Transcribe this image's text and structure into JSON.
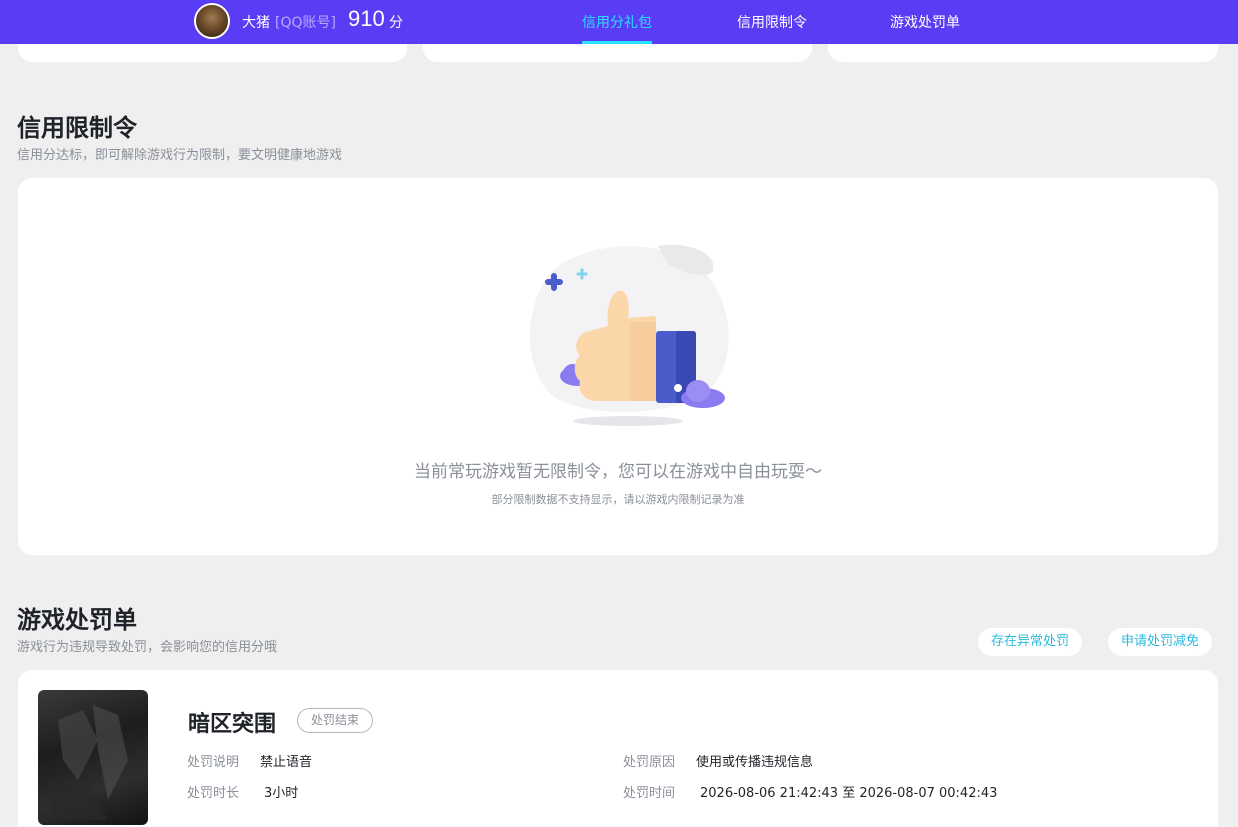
{
  "header": {
    "username": "大猪",
    "account_type": "[QQ账号]",
    "score": "910",
    "score_unit": "分",
    "tabs": [
      {
        "label": "信用分礼包",
        "active": true
      },
      {
        "label": "信用限制令",
        "active": false
      },
      {
        "label": "游戏处罚单",
        "active": false
      }
    ]
  },
  "restriction": {
    "title": "信用限制令",
    "subtitle": "信用分达标，即可解除游戏行为限制，要文明健康地游戏",
    "empty_text": "当前常玩游戏暂无限制令，您可以在游戏中自由玩耍～",
    "empty_note": "部分限制数据不支持显示，请以游戏内限制记录为准"
  },
  "penalty": {
    "title": "游戏处罚单",
    "subtitle": "游戏行为违规导致处罚，会影响您的信用分哦",
    "buttons": {
      "abnormal": "存在异常处罚",
      "reduce": "申请处罚减免"
    },
    "items": [
      {
        "game": "暗区突围",
        "status": "处罚结束",
        "desc_label": "处罚说明",
        "desc": "禁止语音",
        "reason_label": "处罚原因",
        "reason": "使用或传播违规信息",
        "duration_label": "处罚时长",
        "duration": "3小时",
        "time_label": "处罚时间",
        "time": "2026-08-06 21:42:43 至 2026-08-07 00:42:43"
      }
    ]
  },
  "colors": {
    "header_bg": "#5a3cf5",
    "active_tab": "#28e0ff",
    "pill_text": "#2bbbe0"
  }
}
